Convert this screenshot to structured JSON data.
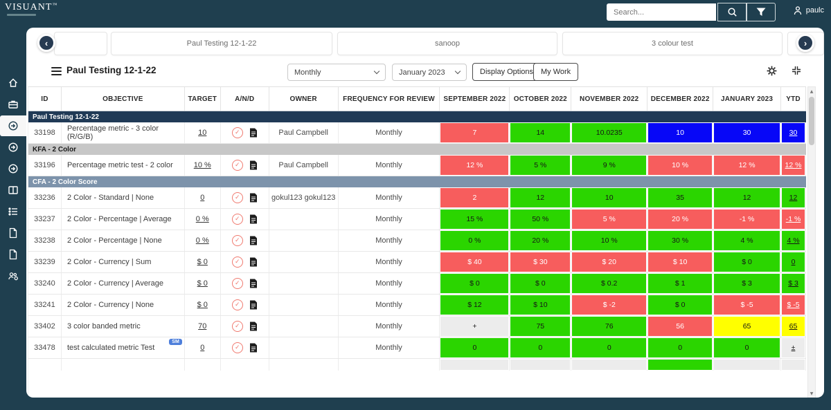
{
  "topbar": {
    "logo": "VISUANT",
    "trademark": "™",
    "search_placeholder": "Search...",
    "username": "paulc"
  },
  "tab_bar": {
    "tabs": [
      "Paul Testing 12-1-22",
      "sanoop",
      "3 colour test"
    ]
  },
  "toolbar": {
    "title": "Paul Testing 12-1-22",
    "frequency_dropdown": "Monthly",
    "period_dropdown": "January 2023",
    "display_options_label": "Display Options",
    "my_work_label": "My Work"
  },
  "icons": {
    "check": "✓",
    "chevron_left": "‹",
    "chevron_right": "›",
    "arrow_up": "▲",
    "arrow_down": "▼"
  },
  "colors": {
    "red": "#F75D5D",
    "green": "#2BD500",
    "blue": "#0707F7",
    "yellow": "#FFFF00",
    "gray": "#ECECEC",
    "section_navy": "#203A56",
    "section_gray": "#C7C7C7",
    "section_steel": "#7D93AB"
  },
  "table": {
    "columns": [
      "ID",
      "OBJECTIVE",
      "TARGET",
      "A/N/D",
      "OWNER",
      "FREQUENCY FOR REVIEW",
      "SEPTEMBER 2022",
      "OCTOBER 2022",
      "NOVEMBER 2022",
      "DECEMBER 2022",
      "JANUARY 2023",
      "YTD"
    ],
    "rows": [
      {
        "type": "section",
        "style": "navy",
        "label": "Paul Testing 12-1-22"
      },
      {
        "type": "data",
        "id": "33198",
        "objective": "Percentage metric - 3 color (R/G/B)",
        "badge": "",
        "target": "10",
        "owner": "Paul Campbell",
        "frequency": "Monthly",
        "cells": [
          {
            "v": "7",
            "c": "red"
          },
          {
            "v": "14",
            "c": "green"
          },
          {
            "v": "10.0235",
            "c": "green"
          },
          {
            "v": "10",
            "c": "blue"
          },
          {
            "v": "30",
            "c": "blue"
          }
        ],
        "ytd": {
          "v": "30",
          "c": "blue"
        }
      },
      {
        "type": "section",
        "style": "gray",
        "label": "KFA - 2 Color"
      },
      {
        "type": "data",
        "id": "33196",
        "objective": "Percentage metric test - 2 color",
        "badge": "",
        "target": "10 %",
        "owner": "Paul Campbell",
        "frequency": "Monthly",
        "cells": [
          {
            "v": "12 %",
            "c": "red"
          },
          {
            "v": "5 %",
            "c": "green"
          },
          {
            "v": "9 %",
            "c": "green"
          },
          {
            "v": "10 %",
            "c": "red"
          },
          {
            "v": "12 %",
            "c": "red"
          }
        ],
        "ytd": {
          "v": "12 %",
          "c": "red"
        }
      },
      {
        "type": "section",
        "style": "steel",
        "label": "CFA - 2 Color Score"
      },
      {
        "type": "data",
        "id": "33236",
        "objective": "2 Color - Standard | None",
        "badge": "",
        "target": "0",
        "owner": "gokul123 gokul123",
        "frequency": "Monthly",
        "cells": [
          {
            "v": "2",
            "c": "red"
          },
          {
            "v": "12",
            "c": "green"
          },
          {
            "v": "10",
            "c": "green"
          },
          {
            "v": "35",
            "c": "green"
          },
          {
            "v": "12",
            "c": "green"
          }
        ],
        "ytd": {
          "v": "12",
          "c": "green"
        }
      },
      {
        "type": "data",
        "id": "33237",
        "objective": "2 Color - Percentage | Average",
        "badge": "",
        "target": "0 %",
        "owner": "",
        "frequency": "Monthly",
        "cells": [
          {
            "v": "15 %",
            "c": "green"
          },
          {
            "v": "50 %",
            "c": "green"
          },
          {
            "v": "5 %",
            "c": "red"
          },
          {
            "v": "20 %",
            "c": "red"
          },
          {
            "v": "-1 %",
            "c": "red"
          }
        ],
        "ytd": {
          "v": "-1 %",
          "c": "red"
        }
      },
      {
        "type": "data",
        "id": "33238",
        "objective": "2 Color - Percentage | None",
        "badge": "",
        "target": "0 %",
        "owner": "",
        "frequency": "Monthly",
        "cells": [
          {
            "v": "0 %",
            "c": "green"
          },
          {
            "v": "20 %",
            "c": "green"
          },
          {
            "v": "10 %",
            "c": "green"
          },
          {
            "v": "30 %",
            "c": "green"
          },
          {
            "v": "4 %",
            "c": "green"
          }
        ],
        "ytd": {
          "v": "4 %",
          "c": "green"
        }
      },
      {
        "type": "data",
        "id": "33239",
        "objective": "2 Color - Currency | Sum",
        "badge": "",
        "target": "$ 0",
        "owner": "",
        "frequency": "Monthly",
        "cells": [
          {
            "v": "$ 40",
            "c": "red"
          },
          {
            "v": "$ 30",
            "c": "red"
          },
          {
            "v": "$ 20",
            "c": "red"
          },
          {
            "v": "$ 10",
            "c": "red"
          },
          {
            "v": "$ 0",
            "c": "green"
          }
        ],
        "ytd": {
          "v": "0",
          "c": "green"
        }
      },
      {
        "type": "data",
        "id": "33240",
        "objective": "2 Color - Currency | Average",
        "badge": "",
        "target": "$ 0",
        "owner": "",
        "frequency": "Monthly",
        "cells": [
          {
            "v": "$ 0",
            "c": "green"
          },
          {
            "v": "$ 0",
            "c": "green"
          },
          {
            "v": "$ 0.2",
            "c": "green"
          },
          {
            "v": "$ 1",
            "c": "green"
          },
          {
            "v": "$ 3",
            "c": "green"
          }
        ],
        "ytd": {
          "v": "$ 3",
          "c": "green"
        }
      },
      {
        "type": "data",
        "id": "33241",
        "objective": "2 Color - Currency | None",
        "badge": "",
        "target": "$ 0",
        "owner": "",
        "frequency": "Monthly",
        "cells": [
          {
            "v": "$ 12",
            "c": "green"
          },
          {
            "v": "$ 10",
            "c": "green"
          },
          {
            "v": "$ -2",
            "c": "red"
          },
          {
            "v": "$ 0",
            "c": "green"
          },
          {
            "v": "$ -5",
            "c": "red"
          }
        ],
        "ytd": {
          "v": "$ -5",
          "c": "red"
        }
      },
      {
        "type": "data",
        "id": "33402",
        "objective": "3 color banded metric",
        "badge": "",
        "target": "70",
        "owner": "",
        "frequency": "Monthly",
        "cells": [
          {
            "v": "+",
            "c": "gray"
          },
          {
            "v": "75",
            "c": "green"
          },
          {
            "v": "76",
            "c": "green"
          },
          {
            "v": "56",
            "c": "red"
          },
          {
            "v": "65",
            "c": "yellow"
          }
        ],
        "ytd": {
          "v": "65",
          "c": "yellow"
        }
      },
      {
        "type": "data",
        "id": "33478",
        "objective": "test calculated metric Test",
        "badge": "SM",
        "target": "0",
        "owner": "",
        "frequency": "Monthly",
        "cells": [
          {
            "v": "0",
            "c": "green"
          },
          {
            "v": "0",
            "c": "green"
          },
          {
            "v": "0",
            "c": "green"
          },
          {
            "v": "0",
            "c": "green"
          },
          {
            "v": "0",
            "c": "green"
          }
        ],
        "ytd": {
          "v": "±",
          "c": "gray"
        }
      },
      {
        "type": "partial",
        "cells": [
          {
            "v": "",
            "c": "gray"
          },
          {
            "v": "",
            "c": "gray"
          },
          {
            "v": "",
            "c": "gray"
          },
          {
            "v": "",
            "c": "green"
          },
          {
            "v": "",
            "c": "gray"
          }
        ],
        "ytd": {
          "v": "",
          "c": "gray"
        }
      }
    ]
  }
}
